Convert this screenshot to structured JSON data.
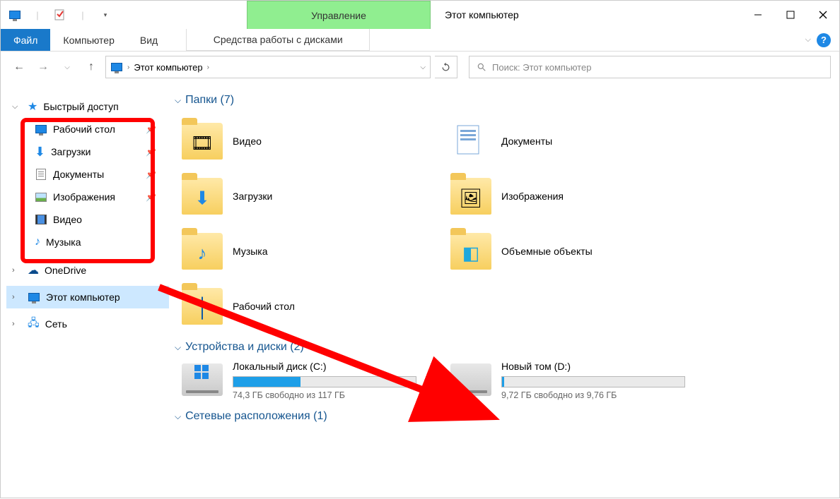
{
  "window": {
    "title": "Этот компьютер",
    "management_tab": "Управление",
    "disk_tools": "Средства работы с дисками"
  },
  "ribbon": {
    "file": "Файл",
    "computer": "Компьютер",
    "view": "Вид"
  },
  "address": {
    "location": "Этот компьютер",
    "search_placeholder": "Поиск: Этот компьютер"
  },
  "sidebar": {
    "quick_access": "Быстрый доступ",
    "items": [
      {
        "label": "Рабочий стол"
      },
      {
        "label": "Загрузки"
      },
      {
        "label": "Документы"
      },
      {
        "label": "Изображения"
      },
      {
        "label": "Видео"
      },
      {
        "label": "Музыка"
      }
    ],
    "onedrive": "OneDrive",
    "this_pc": "Этот компьютер",
    "network": "Сеть"
  },
  "sections": {
    "folders_title": "Папки (7)",
    "devices_title": "Устройства и диски (2)",
    "network_title": "Сетевые расположения (1)"
  },
  "folders": [
    {
      "label": "Видео"
    },
    {
      "label": "Документы"
    },
    {
      "label": "Загрузки"
    },
    {
      "label": "Изображения"
    },
    {
      "label": "Музыка"
    },
    {
      "label": "Объемные объекты"
    },
    {
      "label": "Рабочий стол"
    }
  ],
  "drives": [
    {
      "name": "Локальный диск (C:)",
      "free": "74,3 ГБ свободно из 117 ГБ",
      "fill_pct": 37
    },
    {
      "name": "Новый том (D:)",
      "free": "9,72 ГБ свободно из 9,76 ГБ",
      "fill_pct": 1
    }
  ]
}
